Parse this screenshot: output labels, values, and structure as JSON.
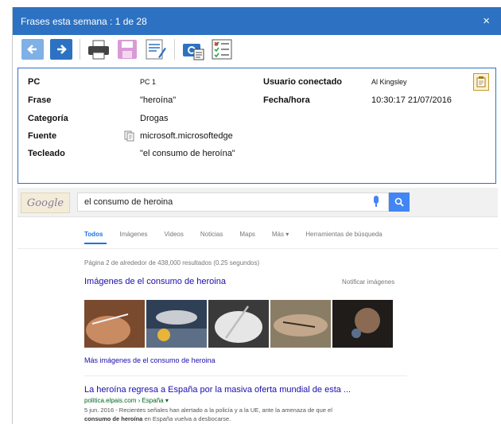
{
  "window": {
    "title": "Frases esta semana : 1 de 28",
    "close_label": "×"
  },
  "toolbar": {
    "icons": [
      "arrow-left-icon",
      "arrow-right-icon",
      "printer-icon",
      "save-icon",
      "edit-document-icon",
      "screenshot-icon",
      "checklist-icon"
    ]
  },
  "details": {
    "pc_label": "PC",
    "pc_value": "PC 1",
    "frase_label": "Frase",
    "frase_value": "\"heroína\"",
    "categoria_label": "Categoría",
    "categoria_value": "Drogas",
    "fuente_label": "Fuente",
    "fuente_value": "microsoft.microsoftedge",
    "tecleado_label": "Tecleado",
    "tecleado_value": "\"el consumo de heroína\"",
    "usuario_label": "Usuario conectado",
    "usuario_value": "Al Kingsley",
    "fecha_label": "Fecha/hora",
    "fecha_value": "10:30:17 21/07/2016"
  },
  "browser": {
    "logo_text": "Google",
    "search_value": "el consumo de heroina",
    "tabs": [
      "Todos",
      "Imágenes",
      "Videos",
      "Noticias",
      "Maps",
      "Más ▾",
      "Herramientas de búsqueda"
    ],
    "stats": "Página 2 de alrededor de 438,000 resultados (0.25 segundos)",
    "images_title": "Imágenes de el consumo de heroina",
    "report_images": "Notificar imágenes",
    "more_images": "Más imágenes de el consumo de heroina",
    "result": {
      "title": "La heroína regresa a España por la masiva oferta mundial de esta ...",
      "url": "politica.elpais.com › España ▾",
      "snippet_1": "5 jun. 2016 - Recientes señales han alertado a la policía y a la UE, ante la amenaza de que el",
      "snippet_bold": "consumo de heroína",
      "snippet_2": " en España vuelva a desbocarse."
    }
  },
  "colors": {
    "titlebar": "#2d72c2",
    "accent": "#4285f4",
    "link": "#1a0dab",
    "url": "#006621"
  }
}
